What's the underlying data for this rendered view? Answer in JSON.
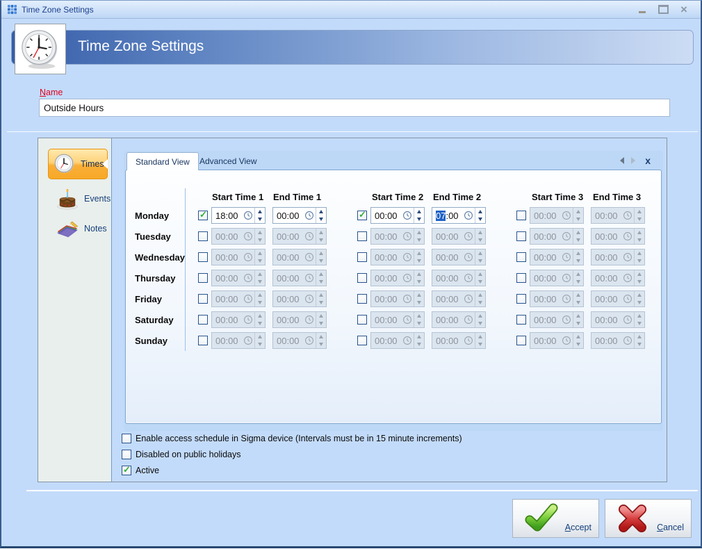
{
  "window": {
    "title": "Time Zone Settings"
  },
  "banner": {
    "title": "Time Zone Settings"
  },
  "name_field": {
    "label": "Name",
    "value": "Outside Hours"
  },
  "sidebar": {
    "items": [
      {
        "id": "times",
        "label": "Times",
        "selected": true
      },
      {
        "id": "events",
        "label": "Events",
        "selected": false
      },
      {
        "id": "notes",
        "label": "Notes",
        "selected": false
      }
    ]
  },
  "tabstrip": {
    "tabs": [
      {
        "label": "Standard View",
        "selected": true
      },
      {
        "label": "Advanced View",
        "selected": false
      }
    ],
    "close_label": "x"
  },
  "schedule": {
    "columns": [
      "Start Time 1",
      "End Time 1",
      "Start Time 2",
      "End Time 2",
      "Start Time 3",
      "End Time 3"
    ],
    "rows": [
      {
        "day": "Monday",
        "slots": [
          {
            "enabled": true,
            "start": "18:00",
            "end": "00:00"
          },
          {
            "enabled": true,
            "start": "00:00",
            "end": "07:00",
            "end_selection": "07"
          },
          {
            "enabled": false,
            "start": "00:00",
            "end": "00:00"
          }
        ]
      },
      {
        "day": "Tuesday",
        "slots": [
          {
            "enabled": false,
            "start": "00:00",
            "end": "00:00"
          },
          {
            "enabled": false,
            "start": "00:00",
            "end": "00:00"
          },
          {
            "enabled": false,
            "start": "00:00",
            "end": "00:00"
          }
        ]
      },
      {
        "day": "Wednesday",
        "slots": [
          {
            "enabled": false,
            "start": "00:00",
            "end": "00:00"
          },
          {
            "enabled": false,
            "start": "00:00",
            "end": "00:00"
          },
          {
            "enabled": false,
            "start": "00:00",
            "end": "00:00"
          }
        ]
      },
      {
        "day": "Thursday",
        "slots": [
          {
            "enabled": false,
            "start": "00:00",
            "end": "00:00"
          },
          {
            "enabled": false,
            "start": "00:00",
            "end": "00:00"
          },
          {
            "enabled": false,
            "start": "00:00",
            "end": "00:00"
          }
        ]
      },
      {
        "day": "Friday",
        "slots": [
          {
            "enabled": false,
            "start": "00:00",
            "end": "00:00"
          },
          {
            "enabled": false,
            "start": "00:00",
            "end": "00:00"
          },
          {
            "enabled": false,
            "start": "00:00",
            "end": "00:00"
          }
        ]
      },
      {
        "day": "Saturday",
        "slots": [
          {
            "enabled": false,
            "start": "00:00",
            "end": "00:00"
          },
          {
            "enabled": false,
            "start": "00:00",
            "end": "00:00"
          },
          {
            "enabled": false,
            "start": "00:00",
            "end": "00:00"
          }
        ]
      },
      {
        "day": "Sunday",
        "slots": [
          {
            "enabled": false,
            "start": "00:00",
            "end": "00:00"
          },
          {
            "enabled": false,
            "start": "00:00",
            "end": "00:00"
          },
          {
            "enabled": false,
            "start": "00:00",
            "end": "00:00"
          }
        ]
      }
    ]
  },
  "options": [
    {
      "label": "Enable access schedule in Sigma device  (Intervals must be in 15 minute increments)",
      "checked": false
    },
    {
      "label": "Disabled on public holidays",
      "checked": false
    },
    {
      "label": "Active",
      "checked": true
    }
  ],
  "footer": {
    "accept_label": "Accept",
    "cancel_label": "Cancel"
  },
  "colors": {
    "accent_orange": "#f7a928",
    "selection_blue": "#2063c6",
    "check_green": "#2fae38",
    "cancel_red": "#c42020",
    "name_label_red": "#e3001b",
    "banner_blue": "#365da9",
    "background_blue": "#c3dbfa"
  }
}
